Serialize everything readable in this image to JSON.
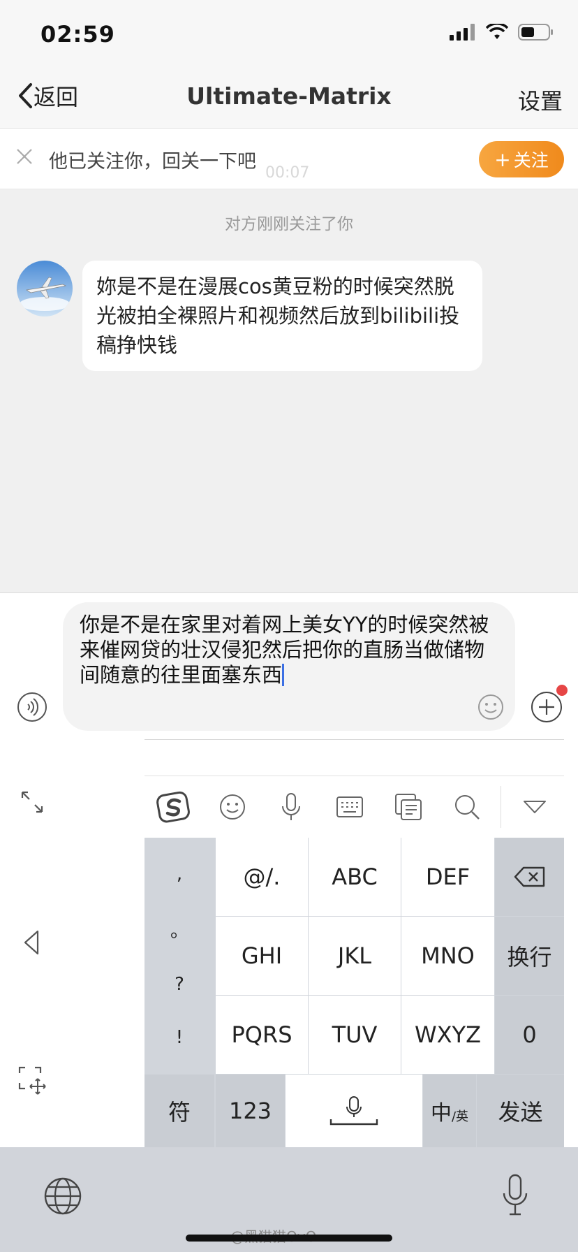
{
  "status_bar": {
    "time": "02:59"
  },
  "nav": {
    "back_label": "返回",
    "title": "Ultimate-Matrix",
    "settings_label": "设置"
  },
  "follow_bar": {
    "text": "他已关注你，回关一下吧",
    "button_label": "关注",
    "ghost_time": "00:07"
  },
  "chat": {
    "system_message": "对方刚刚关注了你",
    "messages": [
      {
        "sender": "other",
        "text": "妳是不是在漫展cos黄豆粉的时候突然脱光被拍全裸照片和视频然后放到bilibili投稿挣快钱"
      }
    ]
  },
  "composer": {
    "draft_text": "你是不是在家里对着网上美女YY的时候突然被来催网贷的壮汉侵犯然后把你的直肠当做储物间随意的往里面塞东西"
  },
  "keyboard": {
    "punctuation": [
      ",",
      "。",
      "?",
      "!"
    ],
    "row1": [
      "@/.",
      "ABC",
      "DEF"
    ],
    "row2": [
      "GHI",
      "JKL",
      "MNO",
      "换行"
    ],
    "row3": [
      "PQRS",
      "TUV",
      "WXYZ",
      "0"
    ],
    "row4": {
      "symbols": "符",
      "numbers": "123",
      "lang_main": "中",
      "lang_sub": "/英",
      "send": "发送"
    }
  },
  "watermark": "@黑猫猫OvO",
  "colors": {
    "accent_orange": "#f39228",
    "caret_blue": "#3b6fe4",
    "badge_red": "#e64646"
  }
}
